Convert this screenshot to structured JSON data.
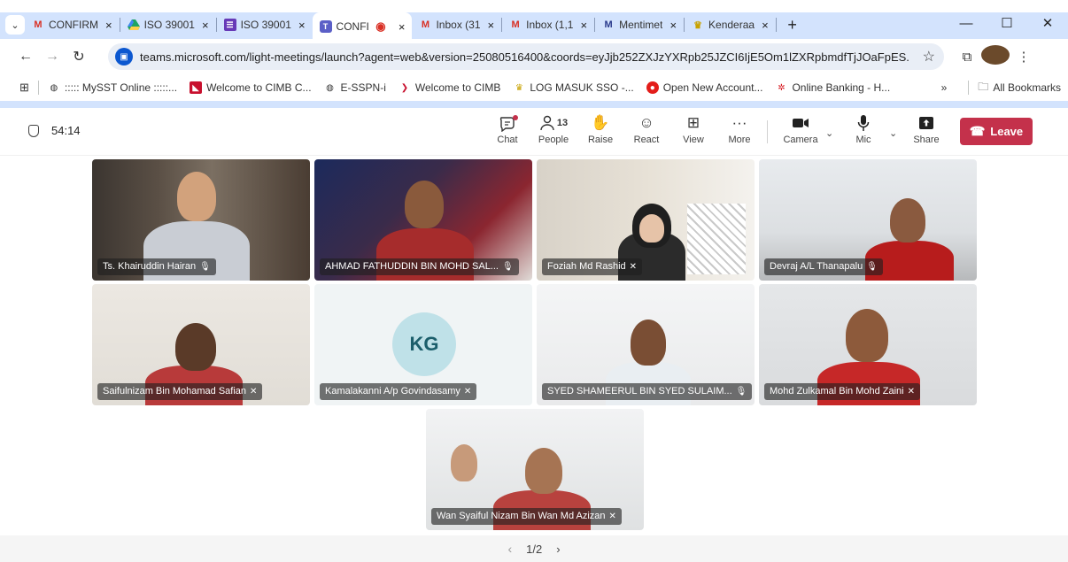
{
  "browser": {
    "tabs": [
      {
        "title": "CONFIRM",
        "icon": "gmail-icon",
        "active": false
      },
      {
        "title": "ISO 39001",
        "icon": "drive-icon",
        "active": false
      },
      {
        "title": "ISO 39001",
        "icon": "forms-icon",
        "active": false
      },
      {
        "title": "CONFI",
        "icon": "teams-icon",
        "active": true
      },
      {
        "title": "Inbox (31",
        "icon": "gmail-icon",
        "active": false
      },
      {
        "title": "Inbox (1,1",
        "icon": "gmail-icon",
        "active": false
      },
      {
        "title": "Mentimet",
        "icon": "menti-icon",
        "active": false
      },
      {
        "title": "Kenderaa",
        "icon": "crest-icon",
        "active": false
      }
    ],
    "url": "teams.microsoft.com/light-meetings/launch?agent=web&version=25080516400&coords=eyJjb252ZXJzYXRpb25JZCI6IjE5Om1lZXRpbmdfTjJOaFpES...",
    "bookmarks": [
      {
        "label": "::::: MySST Online :::::...",
        "icon": "globe-icon"
      },
      {
        "label": "Welcome to CIMB C...",
        "icon": "cimb-icon"
      },
      {
        "label": "E-SSPN-i",
        "icon": "globe-icon"
      },
      {
        "label": "Welcome to CIMB",
        "icon": "cimb-arrow-icon"
      },
      {
        "label": "LOG MASUK SSO -...",
        "icon": "crest-icon"
      },
      {
        "label": "Open New Account...",
        "icon": "bank-icon"
      },
      {
        "label": "Online Banking - H...",
        "icon": "hlb-icon"
      }
    ],
    "all_bookmarks": "All Bookmarks",
    "more_bookmarks": "»"
  },
  "meeting": {
    "timer": "54:14",
    "controls": {
      "chat": "Chat",
      "people": "People",
      "people_count": "13",
      "raise": "Raise",
      "react": "React",
      "view": "View",
      "more": "More",
      "camera": "Camera",
      "mic": "Mic",
      "share": "Share",
      "leave": "Leave"
    },
    "participants": [
      {
        "name": "Ts. Khairuddin Hairan",
        "mic": "mic-on-icon"
      },
      {
        "name": "AHMAD FATHUDDIN BIN MOHD SAL...",
        "mic": "mic-on-icon"
      },
      {
        "name": "Foziah Md Rashid",
        "mic": "mic-muted-icon"
      },
      {
        "name": "Devraj A/L Thanapalu",
        "mic": "mic-on-icon"
      },
      {
        "name": "Saifulnizam Bin Mohamad Safian",
        "mic": "mic-muted-icon"
      },
      {
        "name": "Kamalakanni A/p Govindasamy",
        "mic": "mic-muted-icon",
        "initials": "KG"
      },
      {
        "name": "SYED SHAMEERUL BIN SYED SULAIM...",
        "mic": "mic-on-icon"
      },
      {
        "name": "Mohd Zulkamal Bin Mohd Zaini",
        "mic": "mic-muted-icon"
      },
      {
        "name": "Wan Syaiful Nizam Bin Wan Md Azizan",
        "mic": "mic-muted-icon"
      }
    ],
    "pager": "1/2"
  }
}
